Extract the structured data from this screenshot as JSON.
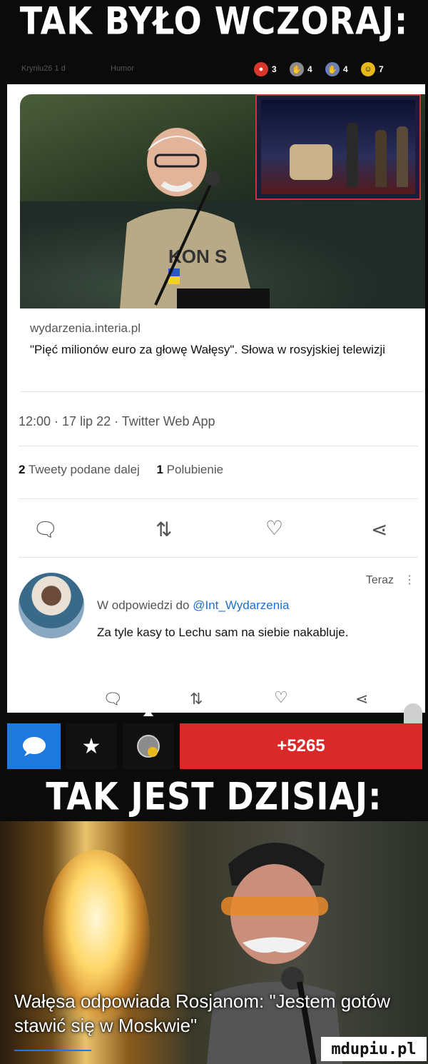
{
  "header": {
    "title": "TAK BYŁO WCZORAJ:"
  },
  "meta": {
    "user": "Kryniu26",
    "age": "1 d",
    "category": "Humor",
    "badges": [
      {
        "icon": "beaver-icon",
        "count": "3",
        "color": "#d9362b"
      },
      {
        "icon": "hand-icon",
        "count": "4",
        "color": "#8c8c8c"
      },
      {
        "icon": "hand-icon",
        "count": "4",
        "color": "#6a7fb0"
      },
      {
        "icon": "emoji-icon",
        "count": "7",
        "color": "#e8b91c"
      }
    ]
  },
  "tweet": {
    "domain": "wydarzenia.interia.pl",
    "headline": "\"Pięć milionów euro za głowę Wałęsy\". Słowa w rosyjskiej telewizji",
    "timestamp": "12:00 · 17 lip 22 · Twitter Web App",
    "retweets_count": "2",
    "retweets_label": "Tweety podane dalej",
    "likes_count": "1",
    "likes_label": "Polubienie",
    "photo_text": "KON S"
  },
  "reply": {
    "time": "Teraz",
    "to_prefix": "W odpowiedzi do",
    "mention": "@Int_Wydarzenia",
    "body": "Za tyle kasy to Lechu sam na siebie nakabluje."
  },
  "actions": {
    "vote_count": "+5265"
  },
  "header2": {
    "title": "TAK JEST DZISIAJ:"
  },
  "photo2": {
    "caption": "Wałęsa odpowiada Rosjanom: \"Jestem gotów stawić się w Moskwie\""
  },
  "logo": {
    "text": "mdupiu.pl"
  }
}
